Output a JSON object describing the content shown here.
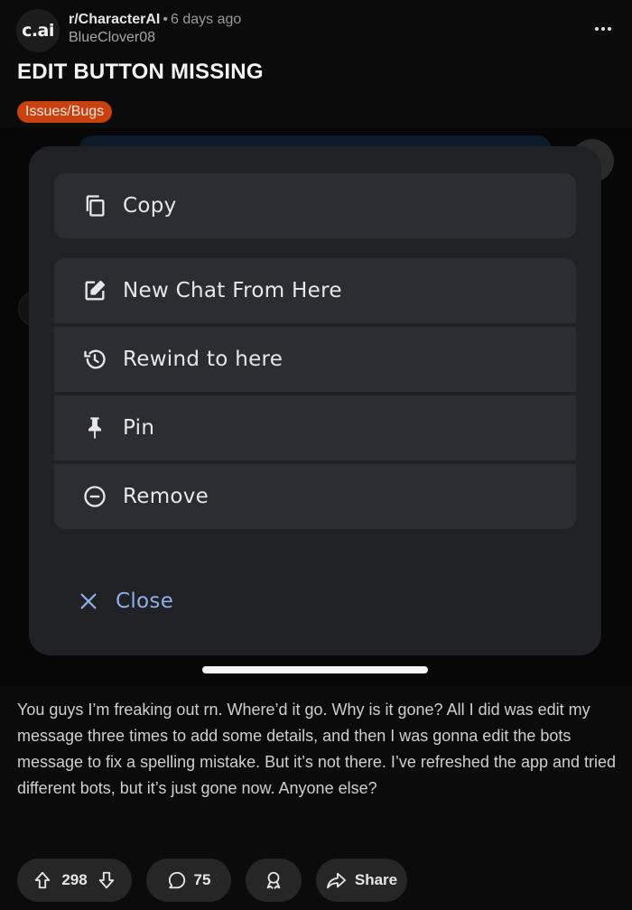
{
  "post": {
    "avatar_text": "c.ai",
    "subreddit": "r/CharacterAI",
    "age": "6 days ago",
    "author": "BlueClover08",
    "title": "EDIT BUTTON MISSING",
    "flair": "Issues/Bugs",
    "body": "You guys I’m freaking out rn. Where’d it go. Why is it gone? All I did was edit my message three times to add some details, and then I was gonna edit the bots message to fix a spelling mistake. But it’s not there. I’ve refreshed the app and tried different bots, but it’s just gone now. Anyone else?"
  },
  "menu": {
    "items": [
      {
        "label": "Copy",
        "icon": "copy-icon"
      },
      {
        "label": "New Chat From Here",
        "icon": "edit-square-icon"
      },
      {
        "label": "Rewind to here",
        "icon": "history-icon"
      },
      {
        "label": "Pin",
        "icon": "pin-icon"
      },
      {
        "label": "Remove",
        "icon": "minus-circle-icon"
      }
    ],
    "close_label": "Close"
  },
  "actions": {
    "votes": "298",
    "comments": "75",
    "share_label": "Share"
  },
  "colors": {
    "flair_bg": "#c8410e",
    "close_blue": "#8fb0e6",
    "sheet_bg": "#202125",
    "item_bg": "#2c2d33"
  }
}
